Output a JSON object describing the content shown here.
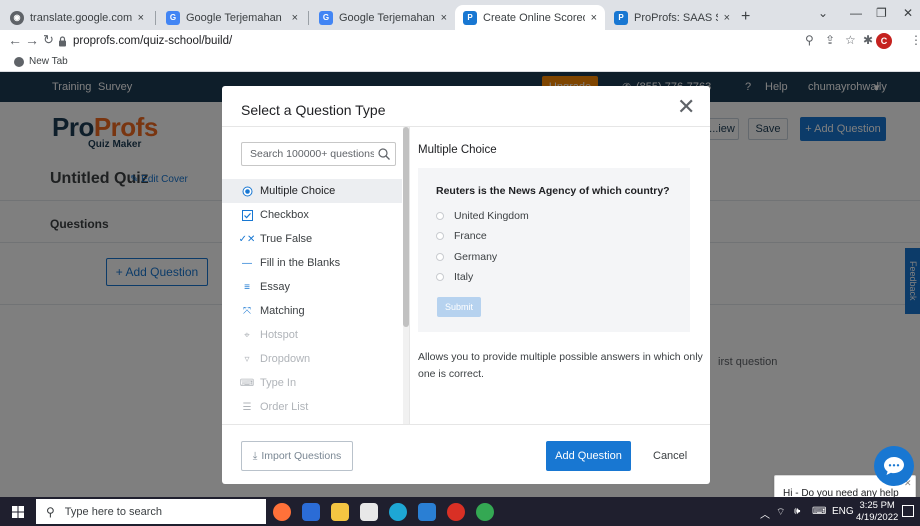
{
  "browser": {
    "tabs": [
      {
        "title": "translate.google.com",
        "close": "×"
      },
      {
        "title": "Google Terjemahan",
        "close": "×"
      },
      {
        "title": "Google Terjemahan",
        "close": "×"
      },
      {
        "title": "Create Online Scored Quizze",
        "close": "×"
      },
      {
        "title": "ProProfs: SAAS Software for",
        "close": "×"
      }
    ],
    "new_tab": "+",
    "url": "proprofs.com/quiz-school/build/",
    "bookmark": "New Tab",
    "profile_initial": "C"
  },
  "page": {
    "nav_links": [
      "Training",
      "Survey"
    ],
    "upgrade": "Upgrade",
    "phone": "(855) 776-7763",
    "help": "Help",
    "user": "chumayrohwally",
    "logo_pro": "Pro",
    "logo_profs": "Profs",
    "logo_sub": "Quiz Maker",
    "btn_preview": "...iew",
    "btn_save": "Save",
    "btn_add_question": "+ Add Question",
    "quiz_title": "Untitled Quiz",
    "edit_cover": "Edit Cover",
    "questions_heading": "Questions",
    "side_add_question": "+ Add Question",
    "hint": "irst question",
    "feedback": "Feedback"
  },
  "modal": {
    "title": "Select a Question Type",
    "close": "✕",
    "search_placeholder": "Search 100000+ questions",
    "question_types": [
      {
        "label": "Multiple Choice",
        "icon": "radio-icon",
        "selected": true,
        "faded": false
      },
      {
        "label": "Checkbox",
        "icon": "checkbox-icon",
        "selected": false,
        "faded": false
      },
      {
        "label": "True False",
        "icon": "true-false-icon",
        "selected": false,
        "faded": false
      },
      {
        "label": "Fill in the Blanks",
        "icon": "blank-icon",
        "selected": false,
        "faded": false
      },
      {
        "label": "Essay",
        "icon": "essay-icon",
        "selected": false,
        "faded": false
      },
      {
        "label": "Matching",
        "icon": "matching-icon",
        "selected": false,
        "faded": false
      },
      {
        "label": "Hotspot",
        "icon": "hotspot-icon",
        "selected": false,
        "faded": true
      },
      {
        "label": "Dropdown",
        "icon": "dropdown-icon",
        "selected": false,
        "faded": true
      },
      {
        "label": "Type In",
        "icon": "type-in-icon",
        "selected": false,
        "faded": true
      },
      {
        "label": "Order List",
        "icon": "order-list-icon",
        "selected": false,
        "faded": true
      }
    ],
    "preview": {
      "heading": "Multiple Choice",
      "question": "Reuters is the News Agency of which country?",
      "options": [
        "United Kingdom",
        "France",
        "Germany",
        "Italy"
      ],
      "submit": "Submit",
      "description": "Allows you to provide multiple possible answers in which only one is correct."
    },
    "import_label": "Import Questions",
    "add_label": "Add Question",
    "cancel_label": "Cancel"
  },
  "chat": {
    "message": "Hi - Do you need any help today?"
  },
  "taskbar": {
    "search_placeholder": "Type here to search",
    "lang": "ENG",
    "time": "3:25 PM",
    "date": "4/19/2022"
  },
  "colors": {
    "accent": "#1877d2",
    "brand_dark": "#1d3c55",
    "brand_orange": "#f26b21",
    "upgrade": "#ff8a00"
  }
}
